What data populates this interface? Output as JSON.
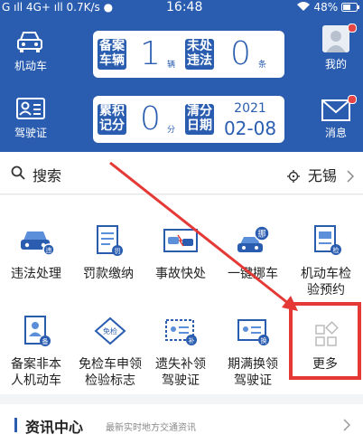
{
  "status_bar": {
    "left": "G ıll 4G+ ıll 0.7K/s ●",
    "time": "16:48",
    "battery": "48%"
  },
  "header": {
    "vehicle_label": "机动车",
    "license_label": "驾驶证",
    "mine_label": "我的",
    "message_label": "消息",
    "registered": {
      "label_line1": "备案",
      "label_line2": "车辆",
      "value": "1",
      "unit": "辆"
    },
    "violations": {
      "label_line1": "未处",
      "label_line2": "违法",
      "value": "0",
      "unit": "条"
    },
    "points": {
      "label_line1": "累积",
      "label_line2": "记分",
      "value": "0",
      "unit": "分"
    },
    "clear": {
      "label_line1": "清分",
      "label_line2": "日期",
      "year": "2021",
      "date": "02-08"
    }
  },
  "search": {
    "placeholder": "搜索",
    "city": "无锡"
  },
  "services": [
    {
      "label1": "违法处理",
      "label2": "",
      "icon": "car-violation-icon"
    },
    {
      "label1": "罚款缴纳",
      "label2": "",
      "icon": "fine-document-icon"
    },
    {
      "label1": "事故快处",
      "label2": "",
      "icon": "accident-icon"
    },
    {
      "label1": "一键挪车",
      "label2": "",
      "icon": "move-car-icon"
    },
    {
      "label1": "机动车检",
      "label2": "验预约",
      "icon": "inspection-icon"
    },
    {
      "label1": "备案非本",
      "label2": "人机动车",
      "icon": "register-icon"
    },
    {
      "label1": "免检车申领",
      "label2": "检验标志",
      "icon": "exempt-badge-icon"
    },
    {
      "label1": "遗失补领",
      "label2": "驾驶证",
      "icon": "lost-license-icon"
    },
    {
      "label1": "期满换领",
      "label2": "驾驶证",
      "icon": "renew-license-icon"
    },
    {
      "label1": "更多",
      "label2": "",
      "icon": "more-icon"
    }
  ],
  "news": {
    "title": "资讯中心",
    "subtitle": "最新实时地方交通资讯"
  },
  "colors": {
    "brand": "#2a5db0",
    "highlight": "#e53935",
    "arrow": "#e53935"
  }
}
